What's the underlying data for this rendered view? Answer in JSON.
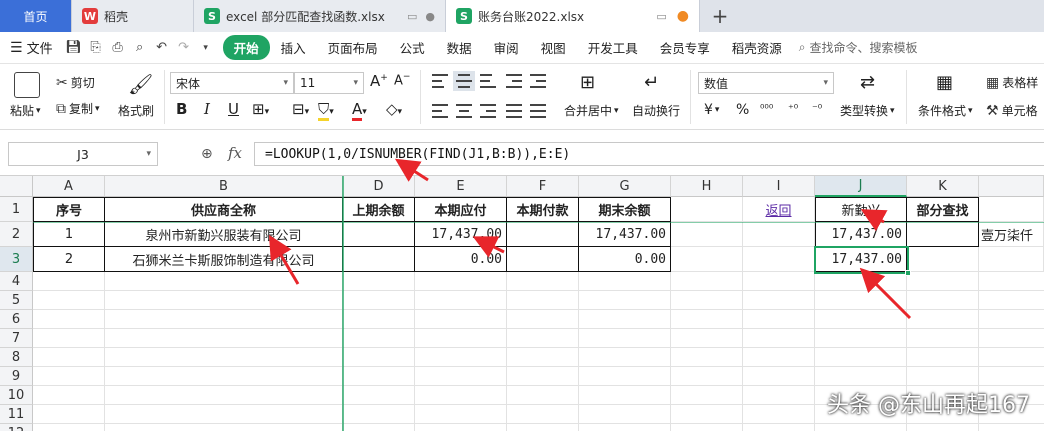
{
  "tabs": [
    {
      "label": "首页"
    },
    {
      "label": "稻壳",
      "icon": "wps-logo-icon"
    },
    {
      "label": "excel 部分匹配查找函数.xlsx",
      "icon": "spreadsheet-icon"
    },
    {
      "label": "账务台账2022.xlsx",
      "icon": "spreadsheet-icon"
    }
  ],
  "menu": {
    "file_label": "文件",
    "items": [
      "开始",
      "插入",
      "页面布局",
      "公式",
      "数据",
      "审阅",
      "视图",
      "开发工具",
      "会员专享",
      "稻壳资源"
    ],
    "active": "开始",
    "search_placeholder": "查找命令、搜索模板"
  },
  "ribbon": {
    "paste": "粘贴",
    "cut": "剪切",
    "copy": "复制",
    "format_painter": "格式刷",
    "font_name": "宋体",
    "font_size": "11",
    "merge_center": "合并居中",
    "wrap_text": "自动换行",
    "number_format": "数值",
    "type_convert": "类型转换",
    "conditional_format": "条件格式",
    "table_style": "表格样",
    "cell_style": "单元格",
    "currency_symbol": "¥",
    "percent_symbol": "%"
  },
  "formula_bar": {
    "cell_ref": "J3",
    "fx": "fx",
    "formula": "=LOOKUP(1,0/ISNUMBER(FIND(J1,B:B)),E:E)"
  },
  "grid": {
    "columns": [
      "A",
      "B",
      "D",
      "E",
      "F",
      "G",
      "H",
      "I",
      "J",
      "K"
    ],
    "selected_column": "J",
    "rows": [
      "1",
      "2",
      "3",
      "4",
      "5",
      "6",
      "7",
      "8",
      "9",
      "10",
      "11",
      "12"
    ],
    "selected_row": "3",
    "header_row": {
      "A": "序号",
      "B": "供应商全称",
      "D": "上期余额",
      "E": "本期应付",
      "F": "本期付款",
      "G": "期末余额",
      "I": "返回",
      "J": "新勤兴",
      "K": "部分查找"
    },
    "data_rows": [
      {
        "A": "1",
        "B": "泉州市新勤兴服装有限公司",
        "D": "",
        "E": "17,437.00",
        "F": "",
        "G": "17,437.00",
        "J": "17,437.00",
        "L": "壹万柒仟"
      },
      {
        "A": "2",
        "B": "石狮米兰卡斯服饰制造有限公司",
        "D": "",
        "E": "0.00",
        "F": "",
        "G": "0.00",
        "J": "17,437.00"
      }
    ]
  },
  "watermark": "头条 @东山再起167",
  "colors": {
    "accent": "#1fa463",
    "tab_home": "#3b6fd8",
    "arrow": "#e8262b"
  }
}
